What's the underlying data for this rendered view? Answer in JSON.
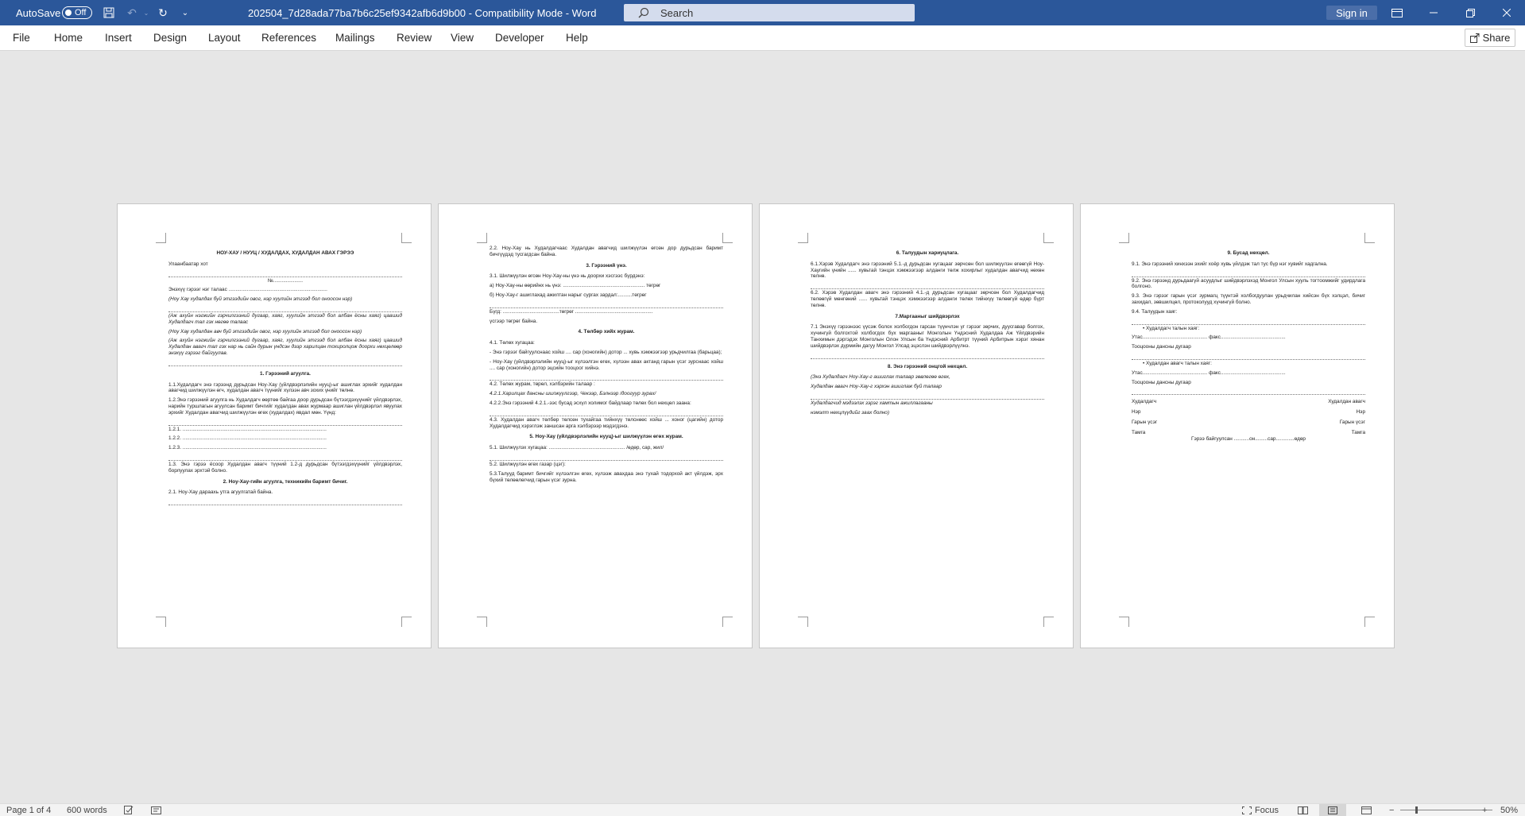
{
  "titlebar": {
    "autosave_label": "AutoSave",
    "autosave_state": "Off",
    "document_title": "202504_7d28ada77ba7b6c25ef9342afb6d9b00  -  Compatibility Mode  -  Word",
    "search_placeholder": "Search",
    "signin_label": "Sign in",
    "accent_color": "#2b579a"
  },
  "ribbon": {
    "tabs": [
      "File",
      "Home",
      "Insert",
      "Design",
      "Layout",
      "References",
      "Mailings",
      "Review",
      "View",
      "Developer",
      "Help"
    ],
    "share_label": "Share"
  },
  "pages": [
    {
      "blocks": [
        {
          "t": "h",
          "x": "НОУ-ХАУ / НУУЦ / ХУДАЛДАХ, ХУДАЛДАН АВАХ ГЭРЭЭ"
        },
        {
          "t": "p",
          "x": "Улаанбаатар хот"
        },
        {
          "t": "c",
          "x": "№....................."
        },
        {
          "t": "p",
          "x": "Энэхүү гэрээг нэг талаас ......................................................................"
        },
        {
          "t": "i",
          "x": "(Ноу Хау худалдах буй этгээдийн овог, нэр хуулийн этгээд бол оноосон нэр)"
        },
        {
          "t": "i",
          "x": "(Аж ахуйн нэгжийн гэрчилгээний дугаар, хаяг, хуулийн этгээд бол албан ёсны хаяг) цаашид Худалдагч тал гэх нөгөө талаас"
        },
        {
          "t": "i",
          "x": "(Ноу Хау худалдан авч буй этгээдийн овог, нэр хуулийн этгээд бол оноосон нэр)"
        },
        {
          "t": "i",
          "x": "(Аж ахуйн нэгжийн гэрчилгээний дугаар, хаяг, хуулийн этгээд бол албан ёсны хаяг) цаашид Худалдан авагч тал гэх нар нь сайн дурын үндсэн дээр харилцан тохиролцож доорхи нөхцөлөөр энэхүү гэрээг байгуулав."
        },
        {
          "t": "h",
          "x": "1. Гэрээний агуулга."
        },
        {
          "t": "p",
          "x": "1.1.Худалдагч энэ гэрээнд дурьдсан Ноу-Хау (үйлдвэрлэлийн нууц)-ыг ашиглах эрхийг худалдан авагчид шилжүүлэн өгч, худалдан авагч түүнийг хүлээн авч зохих үнийг төлнө."
        },
        {
          "t": "p",
          "x": "1.2.Энэ гэрээний агуулга нь Худалдагч өөртөө байгаа доор дурьдсан бүтээгдэхүүнийг үйлдвэрлэх, нарийн туршлагын агуулсан баримт бичгийг худалдан авах журмаар ашиглан үйлдвэрлэл явуулах эрхийг Худалдан авагчид шилжүүлэн өгөх (худалдах) явдал мөн. Үүнд:"
        },
        {
          "t": "p",
          "x": "1.2.1. ......................................................................................................"
        },
        {
          "t": "p",
          "x": "1.2.2. ......................................................................................................"
        },
        {
          "t": "p",
          "x": "1.2.3. ......................................................................................................"
        },
        {
          "t": "p",
          "x": "1.3. Энэ гэрээ ёсоор Худалдан авагч түүний 1.2-д дурьдсан бүтээгдэхүүнийг үйлдвэрлэх, борлуулах эрхтэй болно."
        },
        {
          "t": "h",
          "x": "2. Ноу-Хау-гийн агуулга, техникийн баримт бичиг."
        },
        {
          "t": "p",
          "x": "2.1. Ноу-Хау дараахь утга агуулгатай байна."
        }
      ]
    },
    {
      "blocks": [
        {
          "t": "p",
          "x": "2.2. Ноу-Хау нь Худалдагчаас Худалдан авагчид шилжүүлэн өгсөн дор дурьдсан баримт бичгүүдэд тусгагдсан байна."
        },
        {
          "t": "h",
          "x": "3. Гэрээний үнэ."
        },
        {
          "t": "p",
          "x": "3.1. Шилжүүлэн өгсөн Ноу-Хау-ны үнэ нь доорхи хэсгээс бүрдэнэ:"
        },
        {
          "t": "p",
          "x": "а) Ноу-Хау-ны өөрийнх нь үнэ: .......................................................... төгрөг"
        },
        {
          "t": "p",
          "x": "б) Ноу-Хау-г ашиглахад ажилтан нарыг сургах зардал:..........төгрөг"
        },
        {
          "t": "p",
          "x": "Бүгд: ........................................төгрөг ......................................................."
        },
        {
          "t": "p",
          "x": "үсгээр төгрөг байна."
        },
        {
          "t": "h",
          "x": "4. Төлбөр хийх журам."
        },
        {
          "t": "p",
          "x": "4.1. Төлөх хугацаа:"
        },
        {
          "t": "p",
          "x": "- Энэ гэрээг байгуулснаас хойш .... сар (хоногийн) дотор ... хувь хэмжээгээр урьдчилгаа (барьцаа);"
        },
        {
          "t": "p",
          "x": "- Ноу-Хау (үйлдвэрлэлийн нууц)-ыг хүлээлгэн өгөх, хүлээн авах актанд гарын үсэг зурснаас хойш .... сар (хоногийн) дотор эцсийн тооцоог хийнэ."
        },
        {
          "t": "p",
          "x": "4.2. Төлөх журам, төрөл, хэлбэрийн талаар :"
        },
        {
          "t": "i",
          "x": "4.2.1.Харилцах дансны шилжүүлгээр, Чекээр, Бэлнээр /доогуур зурах/"
        },
        {
          "t": "p",
          "x": "4.2.2.Энэ гэрээний 4.2.1.-ээс бусад эсхүл холимог байдлаар төлөх бол нөхцөл заана:"
        },
        {
          "t": "p",
          "x": "4.3. Худалдан авагч төлбөр төлсөн тухайгаа тийнхүү төлснөөс хойш ... хоног (цагийн) дотор Худалдагчид хэрэглэж заншсан арга хэлбэрээр мэдэгдэнэ."
        },
        {
          "t": "h",
          "x": "5. Ноу-Хау (үйлдвэрлэлийн нууц)-ыг шилжүүлэн өгөх журам."
        },
        {
          "t": "p",
          "x": "5.1. Шилжүүлэх хугацаа: ...................................................... /өдөр, сар, жил/"
        },
        {
          "t": "p",
          "x": "5.2. Шилжүүлэн өгөх газар (цэг):"
        },
        {
          "t": "p",
          "x": "5.3.Талууд баримт бичгийг хүлээлгэн өгөх, хүлээж авахдаа энэ тухай тодорхой акт үйлдэж, эрх бүхий төлөөлөгчид гарын үсэг зурна."
        }
      ]
    },
    {
      "blocks": [
        {
          "t": "h",
          "x": "6. Талуудын хариуцлага."
        },
        {
          "t": "p",
          "x": "6.1.Хэрэв Худалдагч энэ гэрээний 5.1.-д дурьдсан хугацааг зөрчсөн бол шилжүүлэн өгөөгүй Ноу-Хаугийн үнийн ...... хувьтай тэнцэх хэмжээгээр алданги төлж хохирлыг худалдан авагчид нөхөн төлнө."
        },
        {
          "t": "p",
          "x": "6.2. Хэрэв Худалдан авагч энэ гэрээний 4.1.-д дурьдсан хугацааг зөрчсөн бол Худалдагчид төлөөгүй мөнгөний ...... хувьтай тэнцэх хэмжээгээр алданги төлөх тийнхүү төлөөгүй өдөр бүрт төлнө."
        },
        {
          "t": "h",
          "x": "7.Маргааныг шийдвэрлэх"
        },
        {
          "t": "p",
          "x": "7.1 Энэхүү гэрээнээс үүсэж болох холбогдон гарсан түүнчлэн уг гэрээг зөрчих, дуусгавар болгох, хүчингүй болгохтой холбогдох бүх маргааныг Монголын Үндэсний Худалдаа Аж Үйлдвэрийн Танхимын дэргэдэх Монголын Олон Улсын ба Үндэсний Арбитрт түүний Арбитрын хэрэг хянан шийдвэрлэх дүрмийн дагуу Монгол Улсад эцэслэн шийдвэрлүүлнэ."
        },
        {
          "t": "h",
          "x": "8. Энэ гэрээний онцгой нөхцөл."
        },
        {
          "t": "i",
          "x": "(Энэ Худалдагч Ноу-Хау-г ашиглах талаар зөвлөгөө өгөх,"
        },
        {
          "t": "i",
          "x": "Худалдан авагч Ноу-Хау-г хэрхэн ашиглаж буй талаар"
        },
        {
          "t": "i",
          "x": "Худалдагчид мэдээлэх зэрэг хамтын ажиллагааны"
        },
        {
          "t": "i",
          "x": "нэмэлт нөхцлүүдийг заах болно)"
        }
      ]
    },
    {
      "blocks": [
        {
          "t": "h",
          "x": "9. Бусад нөхцөл."
        },
        {
          "t": "p",
          "x": "9.1. Энэ гэрээний хинхээн эхийг хоёр хувь үйлдэж тал тус бүр нэг хувийг хадгална."
        },
        {
          "t": "p",
          "x": "9.2. Энэ гэрээнд дурьдаагүй асуудлыг шийдвэрлэхэд Монгол Улсын хууль тогтоомжийг удирдлага болгоно."
        },
        {
          "t": "p",
          "x": "9.3. Энэ гэрээг гарын үсэг зурмагц түүнтэй холбогдуулан урьдчилан хийсэн бүх хэлцэл, бичиг захидал, зөвшилцөл, протоколууд хүчингүй болно."
        },
        {
          "t": "p",
          "x": "9.4. Талуудын хаяг:"
        },
        {
          "t": "b",
          "x": "Худалдагч талын хаяг:"
        },
        {
          "t": "p",
          "x": "Утас.............................................. факс.............................................."
        },
        {
          "t": "p",
          "x": "Тооцооны дансны дугаар"
        },
        {
          "t": "b",
          "x": "Худалдан авагч талын хаяг:"
        },
        {
          "t": "p",
          "x": "Утас.............................................. факс.............................................."
        },
        {
          "t": "p",
          "x": "Тооцооны дансны дугаар"
        },
        {
          "t": "s",
          "x": "Худалдагч",
          "y": "Худалдан авагч"
        },
        {
          "t": "s",
          "x": "Нэр",
          "y": "Нэр"
        },
        {
          "t": "s",
          "x": "Гарын үсэг",
          "y": "Гарын үсэг"
        },
        {
          "t": "s",
          "x": "Тамга",
          "y": "Тамга"
        },
        {
          "t": "c",
          "x": "Гэрээ байгуулсан ...........он.........сар.............өдөр"
        }
      ]
    }
  ],
  "statusbar": {
    "page_info": "Page 1 of 4",
    "word_count": "600 words",
    "focus_label": "Focus",
    "zoom_level": "50%"
  }
}
